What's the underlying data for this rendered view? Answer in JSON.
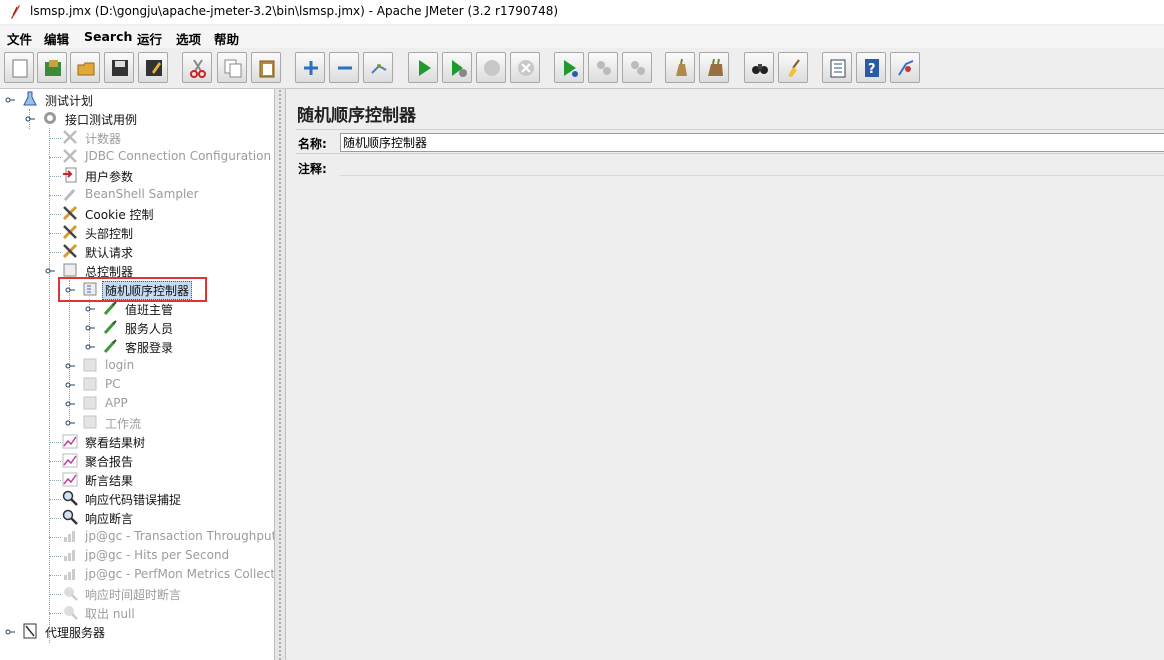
{
  "window": {
    "title": "lsmsp.jmx (D:\\gongju\\apache-jmeter-3.2\\bin\\lsmsp.jmx) - Apache JMeter (3.2 r1790748)"
  },
  "menu": [
    "文件",
    "编辑",
    "Search",
    "运行",
    "选项",
    "帮助"
  ],
  "toolbar": [
    "new-icon",
    "templates-icon",
    "open-icon",
    "save-icon",
    "save-as-icon",
    "cut-icon",
    "copy-icon",
    "paste-icon",
    "expand-icon",
    "collapse-icon",
    "toggle-icon",
    "start-icon",
    "start-no-pause-icon",
    "stop-icon",
    "shutdown-icon",
    "remote-start-icon",
    "remote-stop-icon",
    "remote-exit-icon",
    "clear-icon",
    "clear-all-icon",
    "search-icon",
    "reset-search-icon",
    "function-helper-icon",
    "help-icon",
    "log-viewer-icon"
  ],
  "tree": [
    {
      "label": "测试计划",
      "icon": "flask-icon",
      "enabled": true
    },
    {
      "label": "接口测试用例",
      "icon": "gear-icon",
      "enabled": true
    },
    {
      "label": "计数器",
      "icon": "wrench-icon",
      "enabled": false
    },
    {
      "label": "JDBC Connection Configuration",
      "icon": "wrench-icon",
      "enabled": false
    },
    {
      "label": "用户参数",
      "icon": "arrow-doc-icon",
      "enabled": true
    },
    {
      "label": "BeanShell Sampler",
      "icon": "pipette-icon",
      "enabled": false
    },
    {
      "label": "Cookie 控制",
      "icon": "wrench-icon",
      "enabled": true
    },
    {
      "label": "头部控制",
      "icon": "wrench-icon",
      "enabled": true
    },
    {
      "label": "默认请求",
      "icon": "wrench-icon",
      "enabled": true
    },
    {
      "label": "总控制器",
      "icon": "controller-icon",
      "enabled": true
    },
    {
      "label": "随机顺序控制器",
      "icon": "controller-icon",
      "enabled": true,
      "selected": true
    },
    {
      "label": "值班主管",
      "icon": "pipette-icon",
      "enabled": true
    },
    {
      "label": "服务人员",
      "icon": "pipette-icon",
      "enabled": true
    },
    {
      "label": "客服登录",
      "icon": "pipette-icon",
      "enabled": true
    },
    {
      "label": "login",
      "icon": "controller-icon",
      "enabled": false
    },
    {
      "label": "PC",
      "icon": "controller-icon",
      "enabled": false
    },
    {
      "label": "APP",
      "icon": "controller-icon",
      "enabled": false
    },
    {
      "label": "工作流",
      "icon": "controller-icon",
      "enabled": false
    },
    {
      "label": "察看结果树",
      "icon": "graph-icon",
      "enabled": true
    },
    {
      "label": "聚合报告",
      "icon": "graph-icon",
      "enabled": true
    },
    {
      "label": "断言结果",
      "icon": "graph-icon",
      "enabled": true
    },
    {
      "label": "响应代码错误捕捉",
      "icon": "magnifier-icon",
      "enabled": true
    },
    {
      "label": "响应断言",
      "icon": "magnifier-icon",
      "enabled": true
    },
    {
      "label": "jp@gc - Transaction Throughput vs",
      "icon": "graph-icon",
      "enabled": false
    },
    {
      "label": "jp@gc - Hits per Second",
      "icon": "graph-icon",
      "enabled": false
    },
    {
      "label": "jp@gc - PerfMon Metrics Collector",
      "icon": "graph-icon",
      "enabled": false
    },
    {
      "label": "响应时间超时断言",
      "icon": "magnifier-icon",
      "enabled": false
    },
    {
      "label": "取出 null",
      "icon": "magnifier-icon",
      "enabled": false
    },
    {
      "label": "代理服务器",
      "icon": "proxy-icon",
      "enabled": true
    }
  ],
  "main": {
    "heading": "随机顺序控制器",
    "name_label": "名称:",
    "name_value": "随机顺序控制器",
    "comment_label": "注释:"
  }
}
